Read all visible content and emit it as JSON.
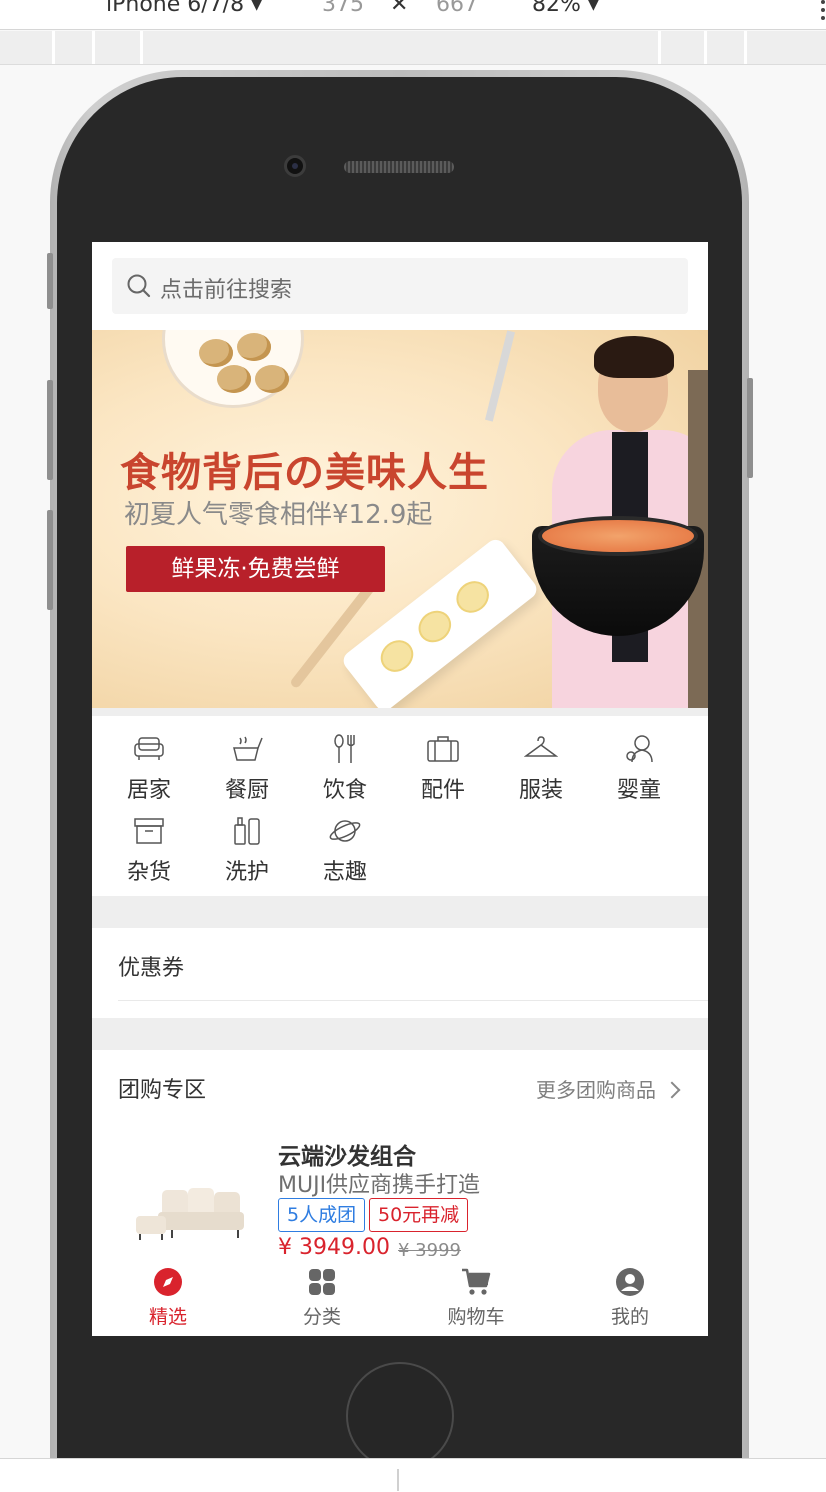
{
  "devtools": {
    "device": "iPhone 6/7/8 ▾",
    "width": "375",
    "times": "✕",
    "height": "667",
    "zoom": "82% ▾"
  },
  "search": {
    "placeholder": "点击前往搜索"
  },
  "banner": {
    "title": "食物背后の美味人生",
    "subtitle": "初夏人气零食相伴¥12.9起",
    "button": "鲜果冻·免费尝鲜"
  },
  "categories": [
    {
      "label": "居家",
      "icon": "sofa-icon"
    },
    {
      "label": "餐厨",
      "icon": "kitchen-pot-icon"
    },
    {
      "label": "饮食",
      "icon": "utensils-icon"
    },
    {
      "label": "配件",
      "icon": "briefcase-icon"
    },
    {
      "label": "服装",
      "icon": "hanger-icon"
    },
    {
      "label": "婴童",
      "icon": "baby-icon"
    },
    {
      "label": "杂货",
      "icon": "storage-box-icon"
    },
    {
      "label": "洗护",
      "icon": "bottles-icon"
    },
    {
      "label": "志趣",
      "icon": "planet-icon"
    }
  ],
  "coupons": {
    "title": "优惠券"
  },
  "group_buy": {
    "title": "团购专区",
    "more": "更多团购商品",
    "product": {
      "name": "云端沙发组合",
      "subtitle": "MUJI供应商携手打造",
      "tag_group": "5人成团",
      "tag_discount": "50元再减",
      "price": "¥ 3949.00",
      "original_price": "¥ 3999"
    }
  },
  "tabbar": [
    {
      "label": "精选",
      "icon": "compass-icon",
      "active": true
    },
    {
      "label": "分类",
      "icon": "grid-icon",
      "active": false
    },
    {
      "label": "购物车",
      "icon": "cart-icon",
      "active": false
    },
    {
      "label": "我的",
      "icon": "user-icon",
      "active": false
    }
  ],
  "colors": {
    "accent_red": "#d9232d",
    "tag_blue": "#2f7de1",
    "banner_red": "#c9452e"
  }
}
